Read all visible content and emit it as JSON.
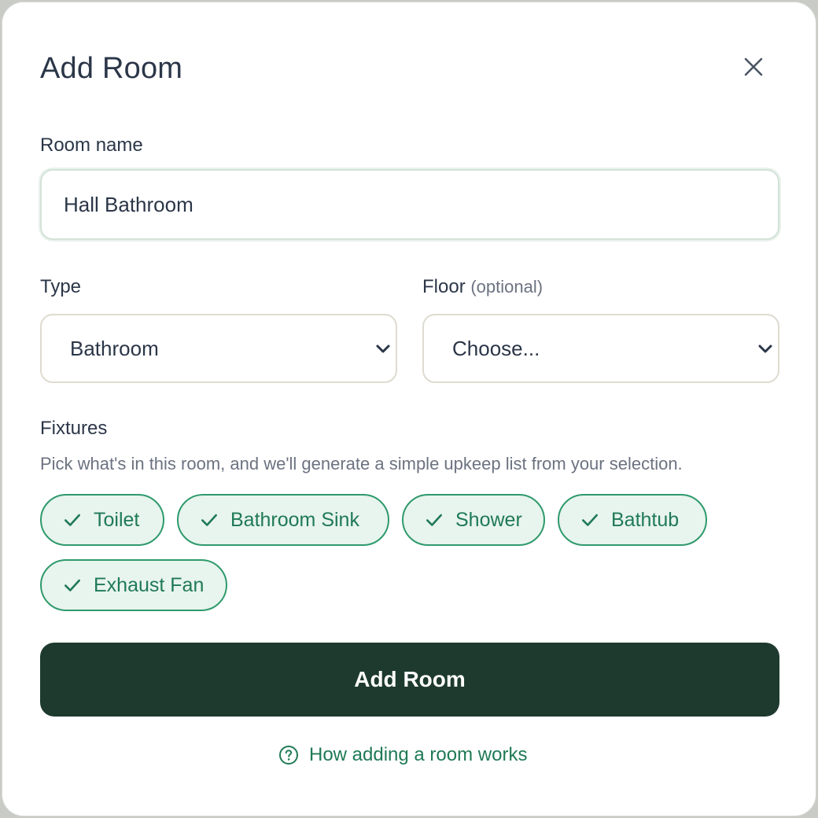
{
  "modal": {
    "title": "Add Room",
    "close_icon": "close-icon"
  },
  "room_name": {
    "label": "Room name",
    "value": "Hall Bathroom"
  },
  "type": {
    "label": "Type",
    "selected": "Bathroom",
    "icon": "chevron-down-icon"
  },
  "floor": {
    "label": "Floor",
    "label_suffix": "(optional)",
    "selected": "Choose...",
    "icon": "chevron-down-icon"
  },
  "fixtures": {
    "label": "Fixtures",
    "helper": "Pick what's in this room, and we'll generate a simple upkeep list from your selection.",
    "chips": [
      {
        "label": "Toilet",
        "selected": true
      },
      {
        "label": "Bathroom Sink",
        "selected": true
      },
      {
        "label": "Shower",
        "selected": true
      },
      {
        "label": "Bathtub",
        "selected": true
      },
      {
        "label": "Exhaust Fan",
        "selected": true
      }
    ]
  },
  "actions": {
    "submit_label": "Add Room",
    "help_link": "How adding a room works",
    "help_icon": "question-circle-icon"
  },
  "colors": {
    "primary_button": "#1e3a2f",
    "accent_green": "#1f7a55",
    "chip_bg": "#e8f4ee",
    "text_dark": "#2b3648"
  }
}
